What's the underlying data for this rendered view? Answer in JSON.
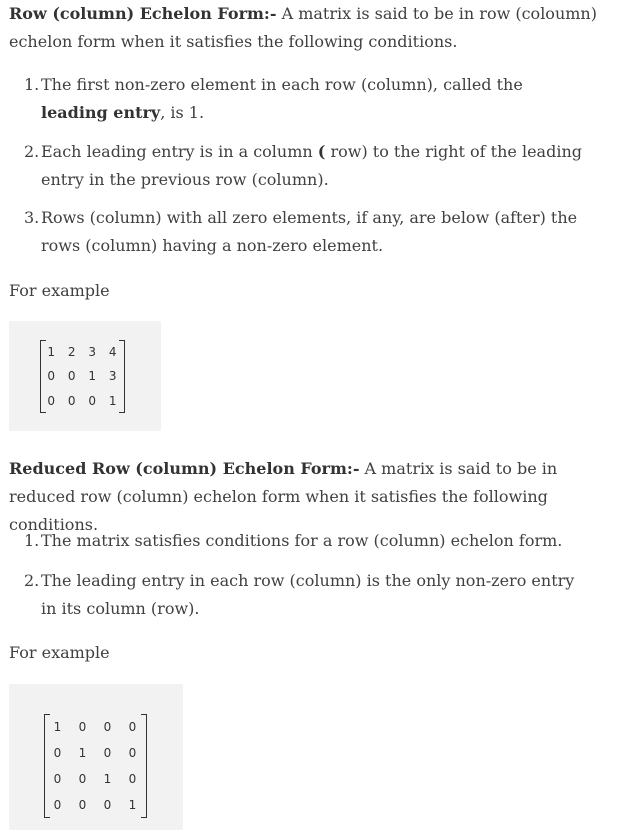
{
  "section1": {
    "heading": "Row (column) Echelon Form:-",
    "intro": " A matrix is said to be in row (coloumn) echelon form when it satisfies the following conditions.",
    "items": [
      {
        "num": "1.",
        "before": "The first non-zero element in each row (column), called the ",
        "bold": "leading entry",
        "after": ", is 1."
      },
      {
        "num": "2.",
        "before": "Each leading entry is in a column ",
        "bold": "(",
        "after": " row) to the right of the leading entry in the previous row (column)."
      },
      {
        "num": "3.",
        "before": "Rows (column) with all zero elements, if any, are below (after) the rows (column) having a non-zero element.",
        "bold": "",
        "after": ""
      }
    ],
    "example_label": "For example",
    "matrix": [
      [
        "1",
        "2",
        "3",
        "4"
      ],
      [
        "0",
        "0",
        "1",
        "3"
      ],
      [
        "0",
        "0",
        "0",
        "1"
      ]
    ]
  },
  "section2": {
    "heading": "Reduced Row (column) Echelon Form:-",
    "intro": " A matrix is said to be in reduced row (column) echelon form when it satisfies the following conditions.",
    "items": [
      {
        "num": "1.",
        "text": "The matrix satisfies conditions for a row (column) echelon form."
      },
      {
        "num": "2.",
        "text": "The leading entry in each row (column) is the only non-zero entry in its column (row)."
      }
    ],
    "example_label": "For example",
    "matrix": [
      [
        "1",
        "0",
        "0",
        "0"
      ],
      [
        "0",
        "1",
        "0",
        "0"
      ],
      [
        "0",
        "0",
        "1",
        "0"
      ],
      [
        "0",
        "0",
        "0",
        "1"
      ]
    ]
  }
}
